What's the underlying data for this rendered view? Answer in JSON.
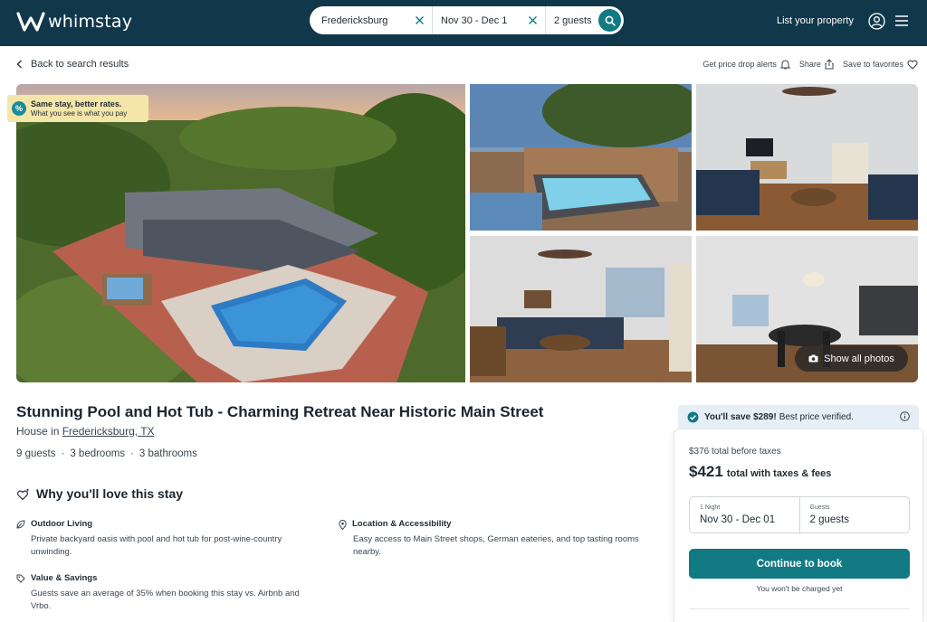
{
  "header": {
    "brand": "whimstay",
    "search": {
      "location": "Fredericksburg",
      "dates": "Nov 30 - Dec 1",
      "guests": "2 guests"
    },
    "list_property": "List your property"
  },
  "subbar": {
    "back": "Back to search results",
    "price_alerts": "Get price drop alerts",
    "share": "Share",
    "save": "Save to favorites"
  },
  "photos": {
    "badge_title": "Same stay, better rates.",
    "badge_sub": "What you see is what you pay",
    "show_all": "Show all photos"
  },
  "listing": {
    "title": "Stunning Pool and Hot Tub - Charming Retreat Near Historic Main Street",
    "type_prefix": "House in",
    "location": "Fredericksburg, TX",
    "guests": "9 guests",
    "bedrooms": "3 bedrooms",
    "bathrooms": "3 bathrooms",
    "dot": "·",
    "why_title": "Why you'll love this stay",
    "features": [
      {
        "title": "Outdoor Living",
        "text": "Private backyard oasis with pool and hot tub for post-wine-country unwinding."
      },
      {
        "title": "Location & Accessibility",
        "text": "Easy access to Main Street shops, German eateries, and top tasting rooms nearby."
      },
      {
        "title": "Value & Savings",
        "text": "Guests save an average of 35% when booking this stay vs. Airbnb and Vrbo."
      }
    ]
  },
  "booking": {
    "save_prefix": "You'll save",
    "save_amount": "$289!",
    "save_suffix": "Best price verified.",
    "before_taxes": "$376 total before taxes",
    "total_amount": "$421",
    "total_label": "total with taxes & fees",
    "nights_label": "1 Night",
    "dates_value": "Nov 30 - Dec 01",
    "guests_label": "Guests",
    "guests_value": "2 guests",
    "cta": "Continue to book",
    "no_charge": "You won't be charged yet"
  },
  "colors": {
    "header_bg": "#10384a",
    "accent": "#117a82",
    "badge_bg": "#f4e6a8",
    "save_bar_bg": "#e6eef7"
  }
}
